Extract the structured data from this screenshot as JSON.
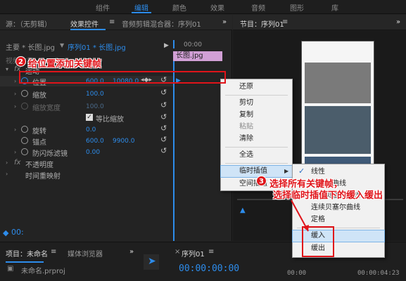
{
  "workspaces": [
    "组件",
    "编辑",
    "颜色",
    "效果",
    "音频",
    "图形",
    "库"
  ],
  "left_panel": {
    "tabs": [
      "源：（无剪辑）",
      "效果控件",
      "音频剪辑混合器：序列01"
    ],
    "overflow": "»",
    "clip_master": "主要 * 长图.jpg",
    "clip_seq": "序列01 * 长图.jpg",
    "ruler_time": "00:00",
    "clip_label": "长图.jpg",
    "section_video": "视频效果",
    "section_motion": "运动",
    "props": {
      "position": {
        "label": "位置",
        "x": "600.0",
        "y": "10080.0"
      },
      "scale": {
        "label": "缩放",
        "value": "100.0"
      },
      "scale_width": {
        "label": "缩放宽度",
        "value": "100.0"
      },
      "uniform_scale": {
        "label": "等比缩放"
      },
      "rotation": {
        "label": "旋转",
        "value": "0.0"
      },
      "anchor": {
        "label": "锚点",
        "x": "600.0",
        "y": "9900.0"
      },
      "flicker": {
        "label": "防闪烁滤镜",
        "value": "0.00"
      },
      "opacity": {
        "label": "不透明度"
      },
      "time_remap": {
        "label": "时间重映射"
      }
    },
    "fx": "fx"
  },
  "program_panel": {
    "title": "节目：序列01",
    "menu": "≡",
    "overflow": "»"
  },
  "context_menu": {
    "items": [
      "还原",
      "剪切",
      "复制",
      "粘贴",
      "清除",
      "全选",
      "临时插值",
      "空间插值"
    ],
    "submenu_arrow": "▶"
  },
  "submenu": {
    "items": [
      "线性",
      "贝塞尔曲线",
      "自动贝塞尔曲线",
      "连续贝塞尔曲线",
      "定格",
      "缓入",
      "缓出"
    ],
    "checked": "线性"
  },
  "annotations": {
    "step2": {
      "num": "2",
      "text": "给位置添加关键帧"
    },
    "step3": {
      "num": "3",
      "line1": "选择所有关键帧，",
      "line2": "选择临时插值下的缓入缓出"
    }
  },
  "bottom": {
    "project_tab": "项目：未命名",
    "media_tab": "媒体浏览器",
    "project_file": "未命名.prproj",
    "sequence_tab": "序列01",
    "timecode": "00:00:00:00",
    "timecode_right": "00:00:04:23",
    "timecode_far": "00:00"
  },
  "colors": {
    "accent": "#2d8ceb",
    "annotation": "#e0141a",
    "menu_bg": "#f1f1f1"
  }
}
